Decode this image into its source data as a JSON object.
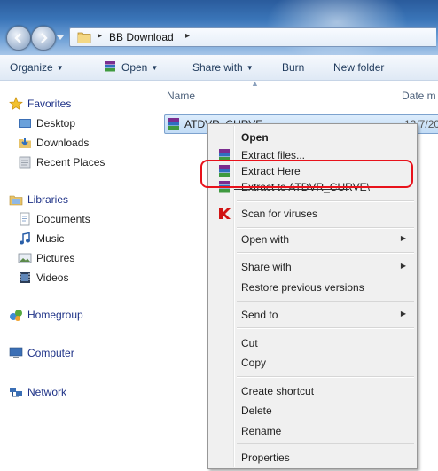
{
  "address": {
    "path": "BB Download",
    "separator": "▸"
  },
  "toolbar": {
    "organize": "Organize",
    "open": "Open",
    "share_with": "Share with",
    "burn": "Burn",
    "new_folder": "New folder",
    "arrow": "▼"
  },
  "nav": {
    "favorites": "Favorites",
    "desktop": "Desktop",
    "downloads": "Downloads",
    "recent_places": "Recent Places",
    "libraries": "Libraries",
    "documents": "Documents",
    "music": "Music",
    "pictures": "Pictures",
    "videos": "Videos",
    "homegroup": "Homegroup",
    "computer": "Computer",
    "network": "Network"
  },
  "columns": {
    "name": "Name",
    "date": "Date m"
  },
  "file": {
    "name": "ATDVR_CURVE",
    "date": "12/7/20"
  },
  "context_menu": {
    "open": "Open",
    "extract_files": "Extract files...",
    "extract_here": "Extract Here",
    "extract_to": "Extract to ATDVR_CURVE\\",
    "scan_for_viruses": "Scan for viruses",
    "open_with": "Open with",
    "share_with": "Share with",
    "restore_previous_versions": "Restore previous versions",
    "send_to": "Send to",
    "cut": "Cut",
    "copy": "Copy",
    "create_shortcut": "Create shortcut",
    "delete": "Delete",
    "rename": "Rename",
    "properties": "Properties",
    "submenu_arrow": "▶"
  },
  "colors": {
    "highlight_border": "#e8121b",
    "titlebar": "#3a75b8"
  }
}
